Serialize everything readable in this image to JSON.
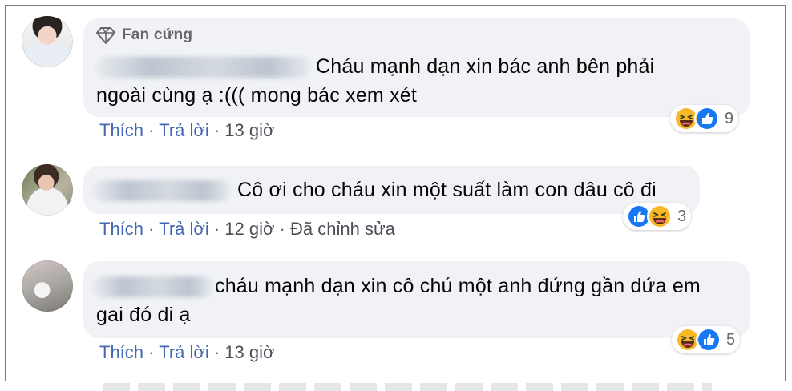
{
  "comments": [
    {
      "badge": "Fan cứng",
      "text_lines": [
        "Cháu mạnh dạn xin bác anh bên phải",
        "ngoài cùng ạ :((( mong bác xem xét"
      ],
      "meta": {
        "like": "Thích",
        "reply": "Trả lời",
        "time": "13 giờ",
        "edited": ""
      },
      "reactions": {
        "icons": [
          "haha-icon",
          "like-icon"
        ],
        "count": "9"
      }
    },
    {
      "badge": "",
      "text_lines": [
        "Cô ơi cho cháu xin một suất làm con dâu cô đi"
      ],
      "meta": {
        "like": "Thích",
        "reply": "Trả lời",
        "time": "12 giờ",
        "edited": "Đã chỉnh sửa"
      },
      "reactions": {
        "icons": [
          "like-icon",
          "haha-icon"
        ],
        "count": "3"
      }
    },
    {
      "badge": "",
      "text_lines": [
        "cháu mạnh dạn xin cô chú một anh đứng gần dứa em",
        "gai đó di ạ"
      ],
      "meta": {
        "like": "Thích",
        "reply": "Trả lời",
        "time": "13 giờ",
        "edited": ""
      },
      "reactions": {
        "icons": [
          "haha-icon",
          "like-icon"
        ],
        "count": "5"
      }
    }
  ],
  "separator": "·",
  "colors": {
    "bubble": "#f0f2f5",
    "link": "#4267b2",
    "meta": "#65676b",
    "like_blue": "#1877f2",
    "haha_yellow": "#f7b928"
  }
}
